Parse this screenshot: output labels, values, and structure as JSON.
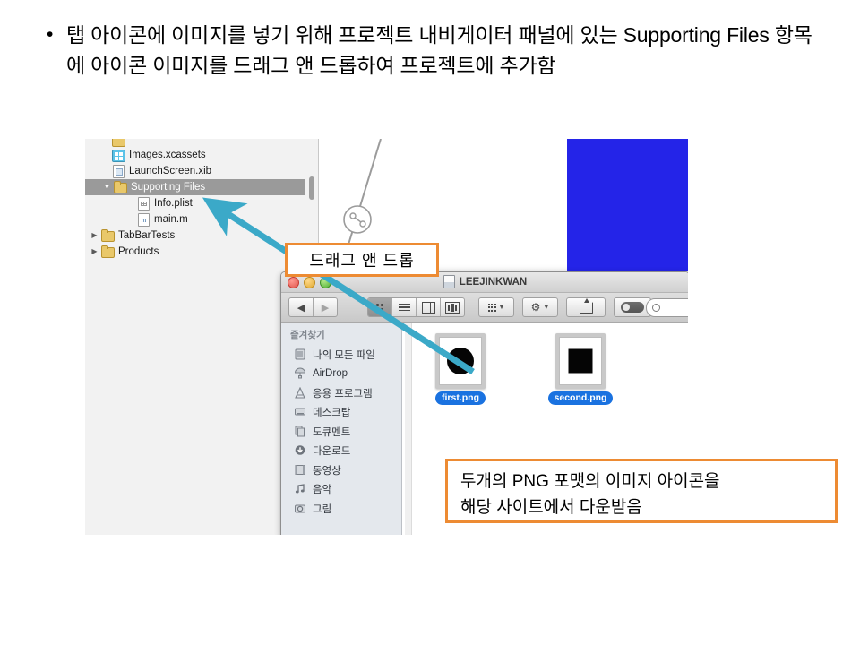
{
  "slide": {
    "bullet": {
      "marker": "•",
      "text": "탭 아이콘에 이미지를 넣기 위해 프로젝트 내비게이터 패널에 있는 Supporting Files 항목에 아이콘 이미지를 드래그 앤 드롭하여 프로젝트에 추가함"
    }
  },
  "colors": {
    "callout_border": "#ed8b33",
    "arrow": "#3ba9c8",
    "selection_gray": "#9a9a9a",
    "label_blue": "#1a72e0",
    "storyboard_view": "#2424e8"
  },
  "navigator": {
    "rows": [
      {
        "label": "",
        "icon": "folder-icon",
        "disclosure": "",
        "indent": 14,
        "selected": false,
        "clipped": true
      },
      {
        "label": "Images.xcassets",
        "icon": "xcassets-icon",
        "disclosure": "",
        "indent": 30,
        "selected": false,
        "clipped": false
      },
      {
        "label": "LaunchScreen.xib",
        "icon": "xib-icon",
        "disclosure": "",
        "indent": 30,
        "selected": false,
        "clipped": false
      },
      {
        "label": "Supporting Files",
        "icon": "folder-icon",
        "disclosure": "▼",
        "indent": 22,
        "selected": true,
        "clipped": false
      },
      {
        "label": "Info.plist",
        "icon": "plist-icon",
        "disclosure": "",
        "indent": 48,
        "selected": false,
        "clipped": false
      },
      {
        "label": "main.m",
        "icon": "objc-m-icon",
        "disclosure": "",
        "indent": 48,
        "selected": false,
        "clipped": false
      },
      {
        "label": "TabBarTests",
        "icon": "folder-icon",
        "disclosure": "▶",
        "indent": 8,
        "selected": false,
        "clipped": false
      },
      {
        "label": "Products",
        "icon": "folder-icon",
        "disclosure": "▶",
        "indent": 8,
        "selected": false,
        "clipped": false
      }
    ]
  },
  "finder": {
    "title": "LEEJINKWAN",
    "nav_back": "◀",
    "nav_forward": "▶",
    "view_buttons": [
      {
        "name": "icon-view",
        "active": true
      },
      {
        "name": "list-view",
        "active": false
      },
      {
        "name": "column-view",
        "active": false
      },
      {
        "name": "coverflow-view",
        "active": false
      }
    ],
    "arrange_label": "arrange-icon",
    "action_label": "gear-icon",
    "share_label": "share-icon",
    "toggle_label": "tag-toggle",
    "search_placeholder": "",
    "sidebar": {
      "header": "즐겨찾기",
      "items": [
        {
          "label": "나의 모든 파일",
          "icon": "all-my-files-icon"
        },
        {
          "label": "AirDrop",
          "icon": "airdrop-icon"
        },
        {
          "label": "응용 프로그램",
          "icon": "applications-icon"
        },
        {
          "label": "데스크탑",
          "icon": "desktop-icon"
        },
        {
          "label": "도큐멘트",
          "icon": "documents-icon"
        },
        {
          "label": "다운로드",
          "icon": "downloads-icon"
        },
        {
          "label": "동영상",
          "icon": "movies-icon"
        },
        {
          "label": "음악",
          "icon": "music-icon"
        },
        {
          "label": "그림",
          "icon": "pictures-icon"
        }
      ]
    },
    "files": [
      {
        "name": "first.png",
        "shape": "circle",
        "selected": true
      },
      {
        "name": "second.png",
        "shape": "square",
        "selected": true
      }
    ]
  },
  "callouts": {
    "drag": "드래그 앤 드롭",
    "download_line1": "두개의 PNG 포맷의 이미지 아이콘을",
    "download_line2": "해당 사이트에서 다운받음"
  }
}
